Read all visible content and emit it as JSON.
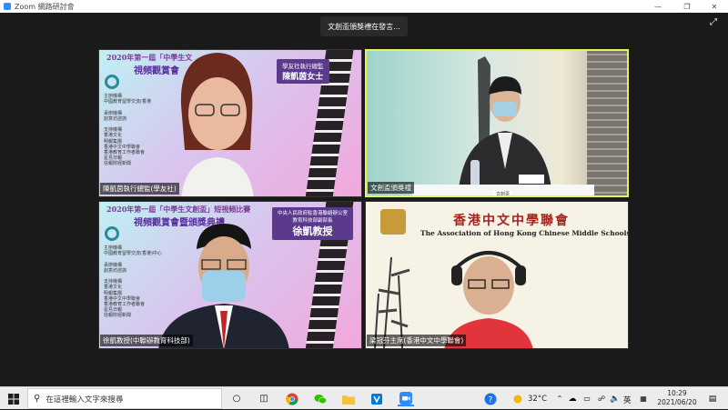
{
  "window": {
    "title": "Zoom 網路研討會",
    "speaking_indicator": "文創盃頒獎禮在發言..."
  },
  "tiles": [
    {
      "name_label": "陳凱茵執行總監(學友社)",
      "poster_head1": "2020年第一屆「中學生文",
      "poster_head2": "視頻觀賞會",
      "nameplate_l1": "學友社執行總監",
      "nameplate_l2": "陳凱茵女士",
      "side_text": "主辦機構\n中國教育留學交流(香港\n\n承辦機構\n創意坊諮詢\n\n支持機構\n香港文化\n明報集團\n香港中文中學聯會\n香港教育工作者聯會\n星島日報\n信報財經新聞"
    },
    {
      "name_label": "文創盃頒獎禮",
      "table_card": "文創盃"
    },
    {
      "name_label": "徐凱教授(中聯辦教育科技部)",
      "poster_head1": "2020年第一屆「中學生文創盃」短視頻比賽",
      "poster_head2": "視頻觀賞會暨頒獎典禮",
      "nameplate_l1": "中央人民政府駐香港聯絡辦公室\n教育科技部副部長",
      "nameplate_l2": "徐凱教授",
      "side_text": "主辦機構\n中國教育留學交流(香港)中心\n\n承辦機構\n創意坊諮詢\n\n支持機構\n香港文化\n明報集團\n香港中文中學聯會\n香港教育工作者聯會\n星島日報\n信報財經新聞"
    },
    {
      "name_label": "梁冠芬主席(香港中文中學聯會)",
      "title_zh": "香港中文中學聯會",
      "title_en": "The Association of Hong Kong Chinese Middle Schools"
    }
  ],
  "taskbar": {
    "search_placeholder": "在這裡輸入文字來搜尋",
    "weather": "32°C",
    "ime": "英",
    "time": "10:29",
    "date": "2021/06/20"
  }
}
